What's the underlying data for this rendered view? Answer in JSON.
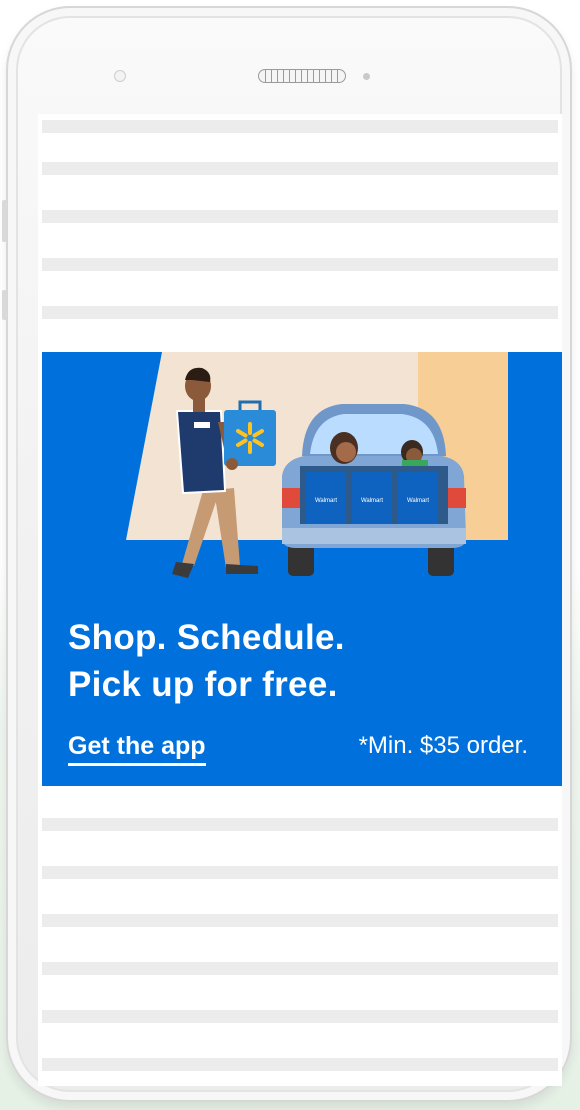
{
  "banner": {
    "headline_line1": "Shop. Schedule.",
    "headline_line2": "Pick up for free.",
    "cta_label": "Get the app",
    "note": "*Min. $35 order.",
    "bag_brand": "Walmart"
  },
  "colors": {
    "banner_blue": "#0071dc",
    "placeholder_stripe": "#ececec",
    "spark_yellow": "#ffc220"
  },
  "icons": {
    "walmart_spark": "spark-icon"
  }
}
